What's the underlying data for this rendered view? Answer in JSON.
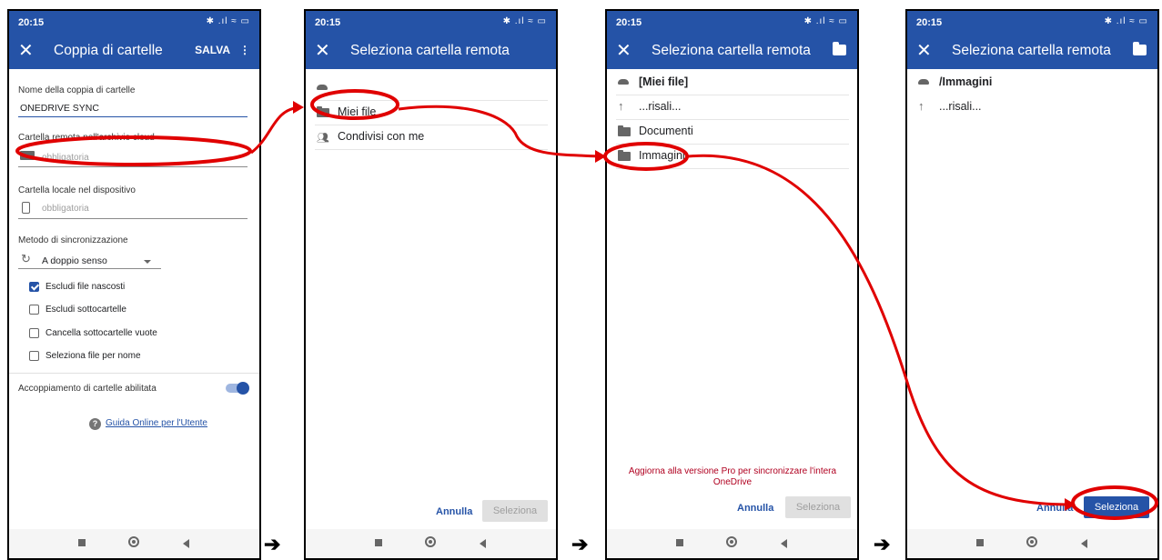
{
  "status": {
    "time": "20:15",
    "icons": "✱ .ıl ≈ ▭"
  },
  "screen1": {
    "title": "Coppia di cartelle",
    "save_label": "SALVA",
    "name_label": "Nome della coppia di cartelle",
    "name_value": "ONEDRIVE SYNC",
    "remote_label": "Cartella remota nell'archivio cloud",
    "remote_placeholder": "obbligatoria",
    "local_label": "Cartella locale nel dispositivo",
    "local_placeholder": "obbligatoria",
    "method_label": "Metodo di sincronizzazione",
    "method_value": "A doppio senso",
    "options": [
      {
        "label": "Escludi file nascosti",
        "checked": true
      },
      {
        "label": "Escludi sottocartelle",
        "checked": false
      },
      {
        "label": "Cancella sottocartelle vuote",
        "checked": false
      },
      {
        "label": "Seleziona file per nome",
        "checked": false
      }
    ],
    "enabled_label": "Accoppiamento di cartelle abilitata",
    "help_link": "Guida Online per l'Utente"
  },
  "screen2": {
    "title": "Seleziona cartella remota",
    "items": [
      "Miei file",
      "Condivisi con me"
    ],
    "cancel": "Annulla",
    "select": "Seleziona"
  },
  "screen3": {
    "title": "Seleziona cartella remota",
    "path": "[Miei file]",
    "up": "...risali...",
    "items": [
      "Documenti",
      "Immagini"
    ],
    "pro_message": "Aggiorna alla versione Pro per sincronizzare l'intera OneDrive",
    "cancel": "Annulla",
    "select": "Seleziona"
  },
  "screen4": {
    "title": "Seleziona cartella remota",
    "path": "/Immagini",
    "up": "...risali...",
    "cancel": "Annulla",
    "select": "Seleziona"
  },
  "step_arrow": "➔",
  "colors": {
    "appbar": "#2553a7",
    "annotation": "#e00000"
  }
}
